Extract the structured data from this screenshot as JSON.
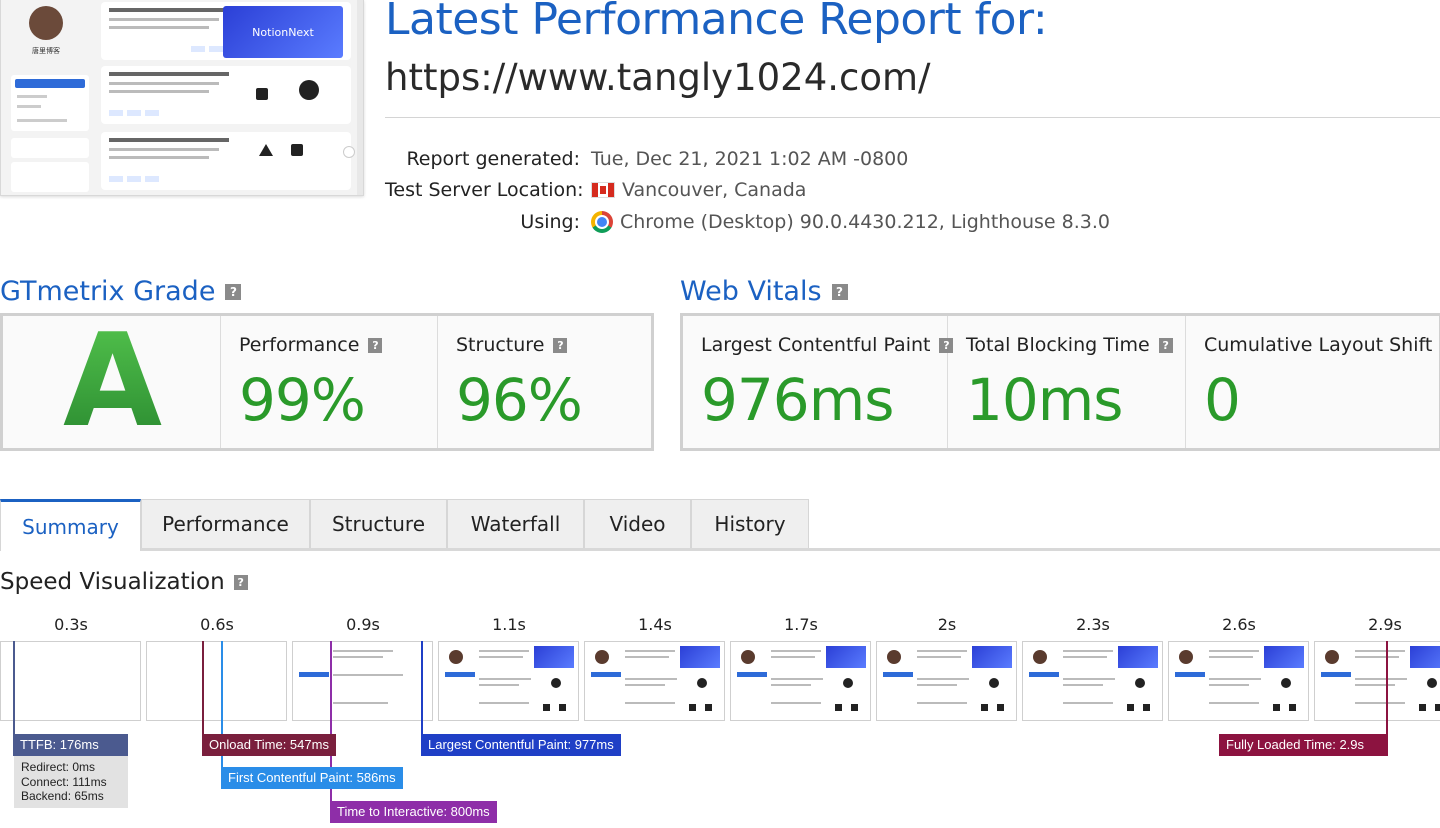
{
  "thumbnail": {
    "site_name": "唐里博客",
    "notion_banner": "NotionNext"
  },
  "header": {
    "title": "Latest Performance Report for:",
    "url": "https://www.tangly1024.com/"
  },
  "meta": {
    "report_generated_label": "Report generated:",
    "report_generated_value": "Tue, Dec 21, 2021 1:02 AM -0800",
    "location_label": "Test Server Location:",
    "location_value": "Vancouver, Canada",
    "using_label": "Using:",
    "using_value": "Chrome (Desktop) 90.0.4430.212, Lighthouse 8.3.0"
  },
  "gtmetrix": {
    "heading": "GTmetrix Grade",
    "grade": "A",
    "performance_label": "Performance",
    "performance_value": "99%",
    "structure_label": "Structure",
    "structure_value": "96%"
  },
  "web_vitals": {
    "heading": "Web Vitals",
    "lcp_label": "Largest Contentful Paint",
    "lcp_value": "976ms",
    "tbt_label": "Total Blocking Time",
    "tbt_value": "10ms",
    "cls_label": "Cumulative Layout Shift",
    "cls_value": "0"
  },
  "help_badge": "?",
  "tabs": [
    "Summary",
    "Performance",
    "Structure",
    "Waterfall",
    "Video",
    "History"
  ],
  "speed": {
    "heading": "Speed Visualization",
    "ticks": [
      "0.3s",
      "0.6s",
      "0.9s",
      "1.1s",
      "1.4s",
      "1.7s",
      "2s",
      "2.3s",
      "2.6s",
      "2.9s"
    ],
    "markers": {
      "ttfb": "TTFB: 176ms",
      "onload": "Onload Time: 547ms",
      "fcp": "First Contentful Paint: 586ms",
      "tti": "Time to Interactive: 800ms",
      "lcp": "Largest Contentful Paint: 977ms",
      "fully_loaded": "Fully Loaded Time: 2.9s"
    },
    "ttfb_detail": {
      "redirect": "Redirect: 0ms",
      "connect": "Connect: 111ms",
      "backend": "Backend: 65ms"
    }
  },
  "colors": {
    "brand_blue": "#1b61c2",
    "grade_green": "#2a9a2a",
    "ttfb": "#4b5a8f",
    "onload": "#7a1f3d",
    "fcp": "#2a8de8",
    "tti": "#8e2ea8",
    "lcp": "#1f3fc6",
    "fully_loaded": "#8c1340"
  }
}
